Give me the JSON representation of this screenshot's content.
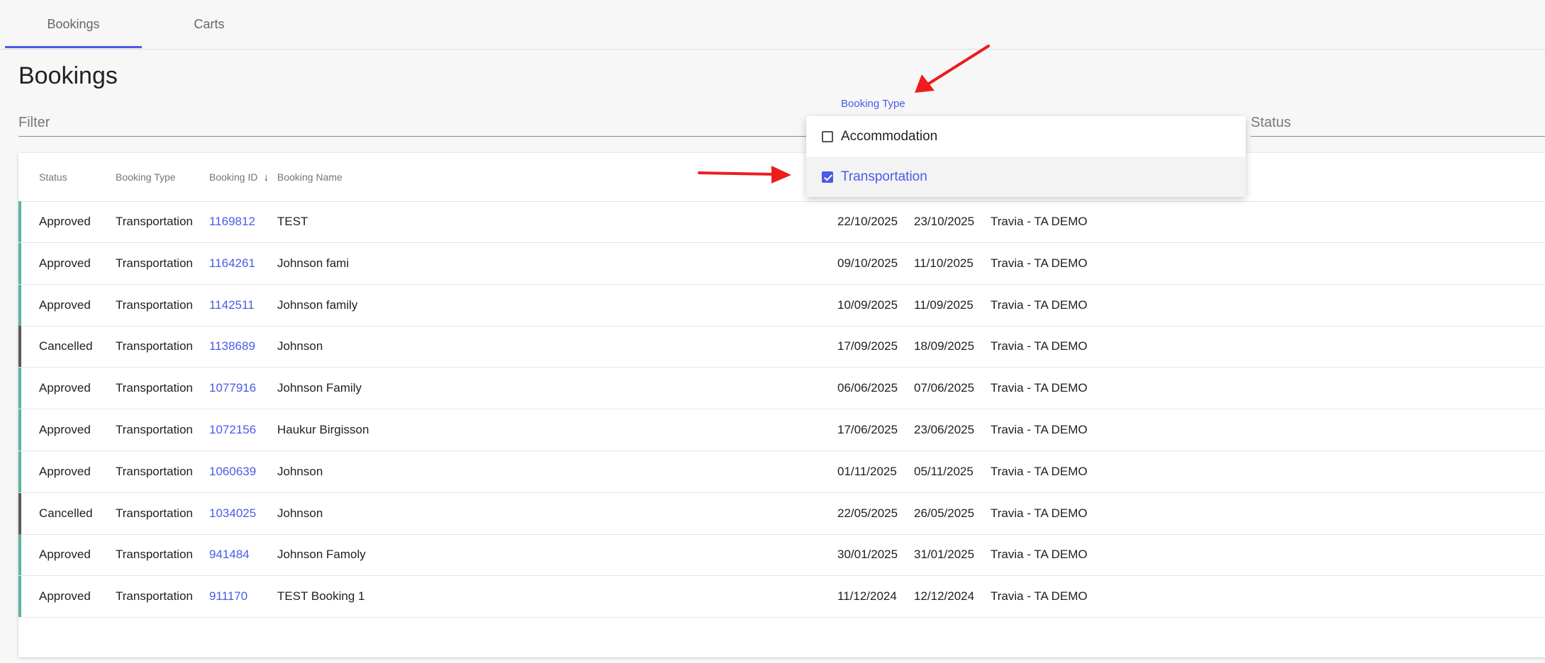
{
  "tabs": [
    {
      "label": "Bookings",
      "active": true
    },
    {
      "label": "Carts",
      "active": false
    }
  ],
  "page_title": "Bookings",
  "filter": {
    "placeholder": "Filter",
    "value": ""
  },
  "status_filter": {
    "label": "Status"
  },
  "booking_type_filter": {
    "label": "Booking Type",
    "options": [
      {
        "label": "Accommodation",
        "checked": false
      },
      {
        "label": "Transportation",
        "checked": true
      }
    ]
  },
  "table": {
    "headers": {
      "status": "Status",
      "booking_type": "Booking Type",
      "booking_id": "Booking ID",
      "booking_name": "Booking Name"
    },
    "sort_icon": "arrow-down-icon",
    "rows": [
      {
        "status": "Approved",
        "type": "Transportation",
        "id": "1169812",
        "name": "TEST",
        "start": "22/10/2025",
        "end": "23/10/2025",
        "agent": "Travia - TA DEMO"
      },
      {
        "status": "Approved",
        "type": "Transportation",
        "id": "1164261",
        "name": "Johnson fami",
        "start": "09/10/2025",
        "end": "11/10/2025",
        "agent": "Travia - TA DEMO"
      },
      {
        "status": "Approved",
        "type": "Transportation",
        "id": "1142511",
        "name": "Johnson family",
        "start": "10/09/2025",
        "end": "11/09/2025",
        "agent": "Travia - TA DEMO"
      },
      {
        "status": "Cancelled",
        "type": "Transportation",
        "id": "1138689",
        "name": "Johnson",
        "start": "17/09/2025",
        "end": "18/09/2025",
        "agent": "Travia - TA DEMO"
      },
      {
        "status": "Approved",
        "type": "Transportation",
        "id": "1077916",
        "name": "Johnson Family",
        "start": "06/06/2025",
        "end": "07/06/2025",
        "agent": "Travia - TA DEMO"
      },
      {
        "status": "Approved",
        "type": "Transportation",
        "id": "1072156",
        "name": "Haukur Birgisson",
        "start": "17/06/2025",
        "end": "23/06/2025",
        "agent": "Travia - TA DEMO"
      },
      {
        "status": "Approved",
        "type": "Transportation",
        "id": "1060639",
        "name": "Johnson",
        "start": "01/11/2025",
        "end": "05/11/2025",
        "agent": "Travia - TA DEMO"
      },
      {
        "status": "Cancelled",
        "type": "Transportation",
        "id": "1034025",
        "name": "Johnson",
        "start": "22/05/2025",
        "end": "26/05/2025",
        "agent": "Travia - TA DEMO"
      },
      {
        "status": "Approved",
        "type": "Transportation",
        "id": "941484",
        "name": "Johnson Famoly",
        "start": "30/01/2025",
        "end": "31/01/2025",
        "agent": "Travia - TA DEMO"
      },
      {
        "status": "Approved",
        "type": "Transportation",
        "id": "911170",
        "name": "TEST Booking 1",
        "start": "11/12/2024",
        "end": "12/12/2024",
        "agent": "Travia - TA DEMO"
      }
    ]
  },
  "colors": {
    "accent": "#4a5be6",
    "approved": "#5fb3a1",
    "cancelled": "#5a5a5a",
    "annotation_arrow": "#ee1c1c"
  }
}
